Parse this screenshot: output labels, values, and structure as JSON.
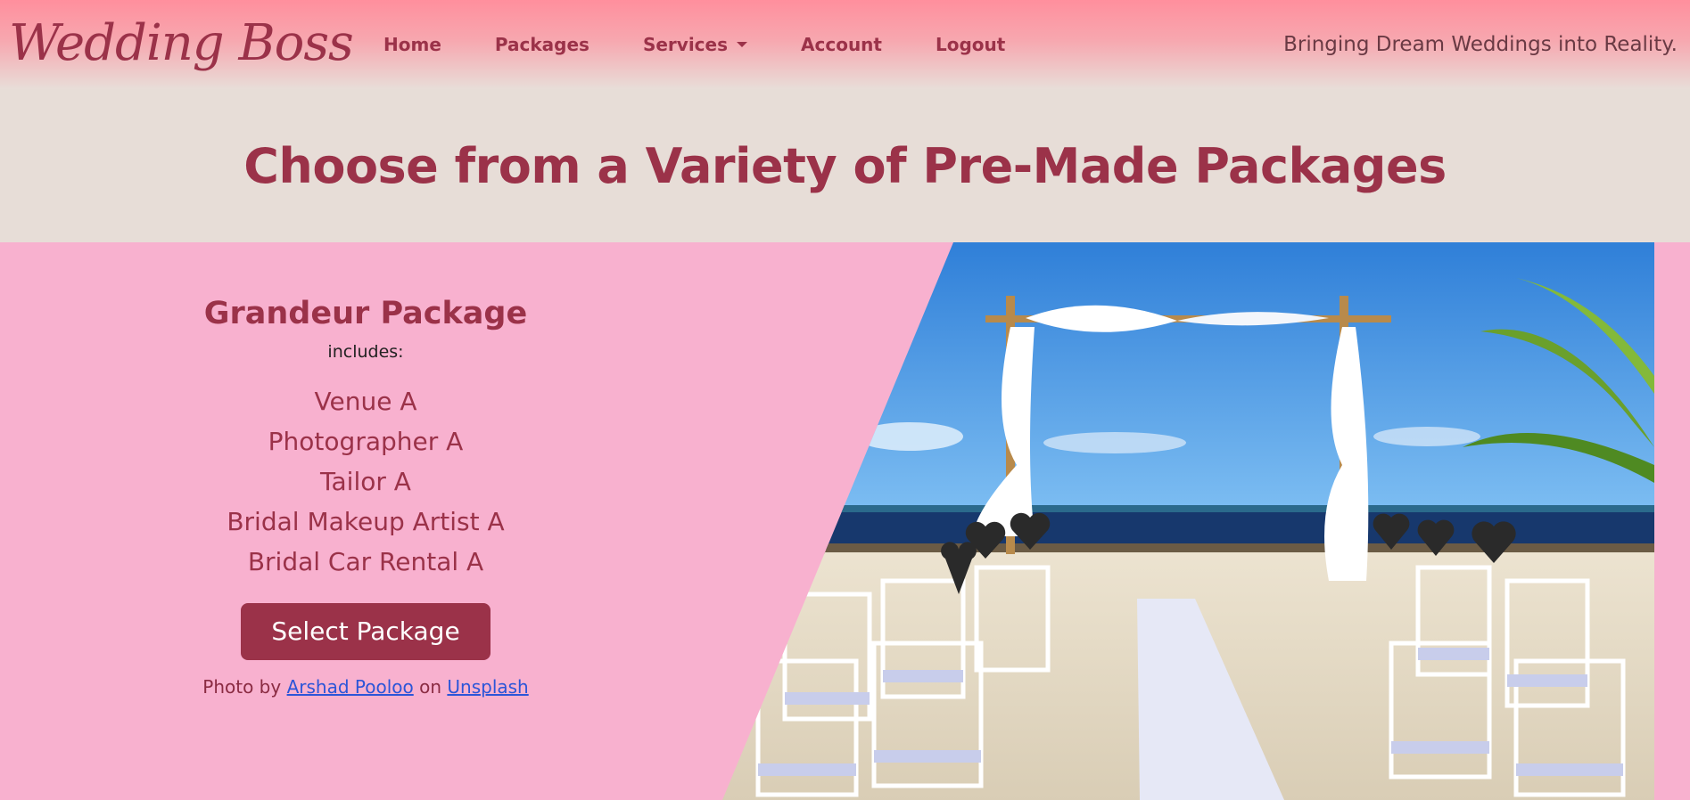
{
  "brand": {
    "name": "Wedding Boss"
  },
  "nav": {
    "items": [
      {
        "label": "Home",
        "has_dropdown": false
      },
      {
        "label": "Packages",
        "has_dropdown": false
      },
      {
        "label": "Services",
        "has_dropdown": true
      },
      {
        "label": "Account",
        "has_dropdown": false
      },
      {
        "label": "Logout",
        "has_dropdown": false
      }
    ],
    "tagline": "Bringing Dream Weddings into Reality."
  },
  "page": {
    "heading": "Choose from a Variety of Pre-Made Packages"
  },
  "package": {
    "title": "Grandeur Package",
    "includes_label": "includes:",
    "vendors": [
      "Venue A",
      "Photographer A",
      "Tailor A",
      "Bridal Makeup Artist A",
      "Bridal Car Rental A"
    ],
    "select_label": "Select Package",
    "credit": {
      "prefix": "Photo by",
      "author": "Arshad Pooloo",
      "connector": "on",
      "source": "Unsplash"
    }
  },
  "colors": {
    "brand": "#9b3249",
    "section_pink": "#f8b1cf",
    "heading_bg": "#e7ddd7",
    "link": "#2c55d8"
  },
  "icons": {
    "services_dropdown": "chevron-down-icon"
  }
}
